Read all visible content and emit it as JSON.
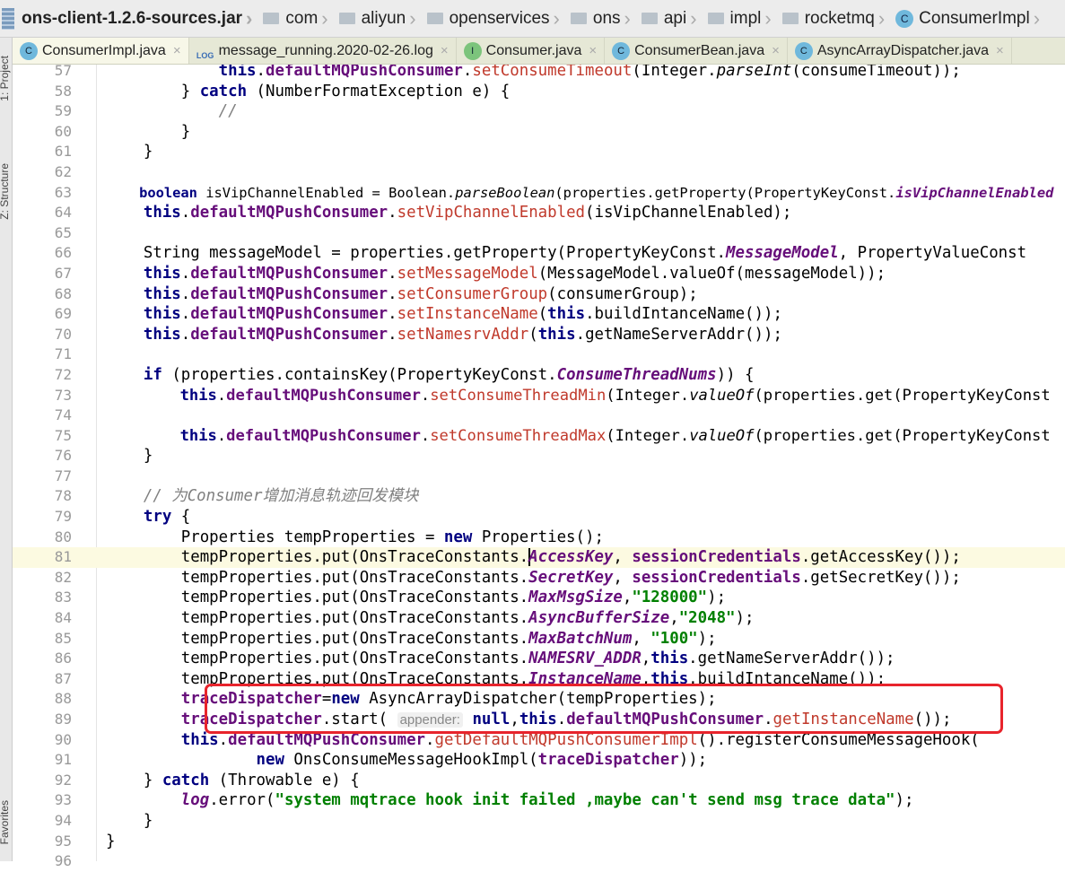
{
  "breadcrumb": {
    "root": "ons-client-1.2.6-sources.jar",
    "folders": [
      "com",
      "aliyun",
      "openservices",
      "ons",
      "api",
      "impl",
      "rocketmq"
    ],
    "class": "ConsumerImpl",
    "class_icon": "C"
  },
  "tabs": [
    {
      "label": "ConsumerImpl.java",
      "icon": "C",
      "active": true
    },
    {
      "label": "message_running.2020-02-26.log",
      "icon": "LOG"
    },
    {
      "label": "Consumer.java",
      "icon": "I"
    },
    {
      "label": "ConsumerBean.java",
      "icon": "C"
    },
    {
      "label": "AsyncArrayDispatcher.java",
      "icon": "C"
    }
  ],
  "side_labels": [
    "1: Project",
    "Z: Structure",
    "Favorites"
  ],
  "current_line": 81,
  "highlight_lines": [
    88,
    89
  ],
  "code": [
    {
      "n": 57,
      "t": [
        [
          "            ",
          ""
        ],
        [
          "this",
          "k"
        ],
        [
          ".",
          ""
        ],
        [
          "defaultMQPushConsumer",
          "f"
        ],
        [
          ".",
          ""
        ],
        [
          "setConsumeTimeout",
          "m"
        ],
        [
          "(Integer.",
          ""
        ],
        [
          "parseInt",
          "si"
        ],
        [
          "(consumeTimeout));",
          ""
        ]
      ]
    },
    {
      "n": 58,
      "t": [
        [
          "        } ",
          ""
        ],
        [
          "catch",
          "k"
        ],
        [
          " (NumberFormatException e) {",
          ""
        ]
      ]
    },
    {
      "n": 59,
      "t": [
        [
          "            ",
          ""
        ],
        [
          "//",
          "c"
        ]
      ]
    },
    {
      "n": 60,
      "t": [
        [
          "        }",
          ""
        ]
      ]
    },
    {
      "n": 61,
      "t": [
        [
          "    }",
          ""
        ]
      ]
    },
    {
      "n": 62,
      "t": []
    },
    {
      "n": 63,
      "t": [
        [
          "    ",
          ""
        ],
        [
          "boolean",
          "k"
        ],
        [
          " isVipChannelEnabled = Boolean.",
          ""
        ],
        [
          "parseBoolean",
          "si"
        ],
        [
          "(properties.getProperty(PropertyKeyConst.",
          ""
        ],
        [
          "isVipChannelEnabled",
          "s"
        ]
      ]
    },
    {
      "n": 64,
      "t": [
        [
          "    ",
          ""
        ],
        [
          "this",
          "k"
        ],
        [
          ".",
          ""
        ],
        [
          "defaultMQPushConsumer",
          "f"
        ],
        [
          ".",
          ""
        ],
        [
          "setVipChannelEnabled",
          "m"
        ],
        [
          "(isVipChannelEnabled);",
          ""
        ]
      ]
    },
    {
      "n": 65,
      "t": []
    },
    {
      "n": 66,
      "t": [
        [
          "    String messageModel = properties.getProperty(PropertyKeyConst.",
          ""
        ],
        [
          "MessageModel",
          "s"
        ],
        [
          ", PropertyValueConst",
          ""
        ]
      ]
    },
    {
      "n": 67,
      "t": [
        [
          "    ",
          ""
        ],
        [
          "this",
          "k"
        ],
        [
          ".",
          ""
        ],
        [
          "defaultMQPushConsumer",
          "f"
        ],
        [
          ".",
          ""
        ],
        [
          "setMessageModel",
          "m"
        ],
        [
          "(MessageModel.valueOf(messageModel));",
          ""
        ]
      ]
    },
    {
      "n": 68,
      "t": [
        [
          "    ",
          ""
        ],
        [
          "this",
          "k"
        ],
        [
          ".",
          ""
        ],
        [
          "defaultMQPushConsumer",
          "f"
        ],
        [
          ".",
          ""
        ],
        [
          "setConsumerGroup",
          "m"
        ],
        [
          "(consumerGroup);",
          ""
        ]
      ]
    },
    {
      "n": 69,
      "t": [
        [
          "    ",
          ""
        ],
        [
          "this",
          "k"
        ],
        [
          ".",
          ""
        ],
        [
          "defaultMQPushConsumer",
          "f"
        ],
        [
          ".",
          ""
        ],
        [
          "setInstanceName",
          "m"
        ],
        [
          "(",
          ""
        ],
        [
          "this",
          "k"
        ],
        [
          ".buildIntanceName());",
          ""
        ]
      ]
    },
    {
      "n": 70,
      "t": [
        [
          "    ",
          ""
        ],
        [
          "this",
          "k"
        ],
        [
          ".",
          ""
        ],
        [
          "defaultMQPushConsumer",
          "f"
        ],
        [
          ".",
          ""
        ],
        [
          "setNamesrvAddr",
          "m"
        ],
        [
          "(",
          ""
        ],
        [
          "this",
          "k"
        ],
        [
          ".getNameServerAddr());",
          ""
        ]
      ]
    },
    {
      "n": 71,
      "t": []
    },
    {
      "n": 72,
      "t": [
        [
          "    ",
          ""
        ],
        [
          "if",
          "k"
        ],
        [
          " (properties.containsKey(PropertyKeyConst.",
          ""
        ],
        [
          "ConsumeThreadNums",
          "s"
        ],
        [
          ")) {",
          ""
        ]
      ]
    },
    {
      "n": 73,
      "t": [
        [
          "        ",
          ""
        ],
        [
          "this",
          "k"
        ],
        [
          ".",
          ""
        ],
        [
          "defaultMQPushConsumer",
          "f"
        ],
        [
          ".",
          ""
        ],
        [
          "setConsumeThreadMin",
          "m"
        ],
        [
          "(Integer.",
          ""
        ],
        [
          "valueOf",
          "si"
        ],
        [
          "(properties.get(PropertyKeyConst",
          ""
        ]
      ]
    },
    {
      "n": 74,
      "t": []
    },
    {
      "n": 75,
      "t": [
        [
          "        ",
          ""
        ],
        [
          "this",
          "k"
        ],
        [
          ".",
          ""
        ],
        [
          "defaultMQPushConsumer",
          "f"
        ],
        [
          ".",
          ""
        ],
        [
          "setConsumeThreadMax",
          "m"
        ],
        [
          "(Integer.",
          ""
        ],
        [
          "valueOf",
          "si"
        ],
        [
          "(properties.get(PropertyKeyConst",
          ""
        ]
      ]
    },
    {
      "n": 76,
      "t": [
        [
          "    }",
          ""
        ]
      ]
    },
    {
      "n": 77,
      "t": []
    },
    {
      "n": 78,
      "t": [
        [
          "    ",
          ""
        ],
        [
          "// 为",
          "c"
        ],
        [
          "Consumer",
          "c"
        ],
        [
          "增加消息轨迹回发模块",
          "c"
        ]
      ]
    },
    {
      "n": 79,
      "t": [
        [
          "    ",
          ""
        ],
        [
          "try",
          "k"
        ],
        [
          " {",
          ""
        ]
      ]
    },
    {
      "n": 80,
      "t": [
        [
          "        Properties tempProperties = ",
          ""
        ],
        [
          "new",
          "k"
        ],
        [
          " Properties();",
          ""
        ]
      ]
    },
    {
      "n": 81,
      "t": [
        [
          "        tempProperties.put(OnsTraceConstants.",
          ""
        ],
        [
          "AccessKey",
          "s"
        ],
        [
          ", ",
          ""
        ],
        [
          "sessionCredentials",
          "f"
        ],
        [
          ".getAccessKey());",
          ""
        ]
      ]
    },
    {
      "n": 82,
      "t": [
        [
          "        tempProperties.put(OnsTraceConstants.",
          ""
        ],
        [
          "SecretKey",
          "s"
        ],
        [
          ", ",
          ""
        ],
        [
          "sessionCredentials",
          "f"
        ],
        [
          ".getSecretKey());",
          ""
        ]
      ]
    },
    {
      "n": 83,
      "t": [
        [
          "        tempProperties.put(OnsTraceConstants.",
          ""
        ],
        [
          "MaxMsgSize",
          "s"
        ],
        [
          ",",
          ""
        ],
        [
          "\"128000\"",
          "str"
        ],
        [
          ");",
          ""
        ]
      ]
    },
    {
      "n": 84,
      "t": [
        [
          "        tempProperties.put(OnsTraceConstants.",
          ""
        ],
        [
          "AsyncBufferSize",
          "s"
        ],
        [
          ",",
          ""
        ],
        [
          "\"2048\"",
          "str"
        ],
        [
          ");",
          ""
        ]
      ]
    },
    {
      "n": 85,
      "t": [
        [
          "        tempProperties.put(OnsTraceConstants.",
          ""
        ],
        [
          "MaxBatchNum",
          "s"
        ],
        [
          ", ",
          ""
        ],
        [
          "\"100\"",
          "str"
        ],
        [
          ");",
          ""
        ]
      ]
    },
    {
      "n": 86,
      "t": [
        [
          "        tempProperties.put(OnsTraceConstants.",
          ""
        ],
        [
          "NAMESRV_ADDR",
          "s"
        ],
        [
          ",",
          ""
        ],
        [
          "this",
          "k"
        ],
        [
          ".getNameServerAddr());",
          ""
        ]
      ]
    },
    {
      "n": 87,
      "t": [
        [
          "        tempProperties.put(OnsTraceConstants.",
          ""
        ],
        [
          "InstanceName",
          "s"
        ],
        [
          ",",
          ""
        ],
        [
          "this",
          "k"
        ],
        [
          ".buildIntanceName());",
          ""
        ]
      ]
    },
    {
      "n": 88,
      "t": [
        [
          "        ",
          ""
        ],
        [
          "traceDispatcher",
          "f"
        ],
        [
          "=",
          ""
        ],
        [
          "new",
          "k"
        ],
        [
          " AsyncArrayDispatcher(tempProperties);",
          ""
        ]
      ]
    },
    {
      "n": 89,
      "t": [
        [
          "        ",
          ""
        ],
        [
          "traceDispatcher",
          "f"
        ],
        [
          ".start( ",
          ""
        ],
        [
          "appender:",
          "h"
        ],
        [
          " ",
          ""
        ],
        [
          "null",
          "k"
        ],
        [
          ",",
          ""
        ],
        [
          "this",
          "k"
        ],
        [
          ".",
          ""
        ],
        [
          "defaultMQPushConsumer",
          "f"
        ],
        [
          ".",
          ""
        ],
        [
          "getInstanceName",
          "m"
        ],
        [
          "());",
          ""
        ]
      ]
    },
    {
      "n": 90,
      "t": [
        [
          "        ",
          ""
        ],
        [
          "this",
          "k"
        ],
        [
          ".",
          ""
        ],
        [
          "defaultMQPushConsumer",
          "f"
        ],
        [
          ".",
          ""
        ],
        [
          "getDefaultMQPushConsumerImpl",
          "m"
        ],
        [
          "().registerConsumeMessageHook(",
          ""
        ]
      ]
    },
    {
      "n": 91,
      "t": [
        [
          "                ",
          ""
        ],
        [
          "new",
          "k"
        ],
        [
          " OnsConsumeMessageHookImpl(",
          ""
        ],
        [
          "traceDispatcher",
          "f"
        ],
        [
          "));",
          ""
        ]
      ]
    },
    {
      "n": 92,
      "t": [
        [
          "    } ",
          ""
        ],
        [
          "catch",
          "k"
        ],
        [
          " (Throwable e) {",
          ""
        ]
      ]
    },
    {
      "n": 93,
      "t": [
        [
          "        ",
          ""
        ],
        [
          "log",
          "s"
        ],
        [
          ".error(",
          ""
        ],
        [
          "\"system mqtrace hook init failed ,maybe can't send msg trace data\"",
          "str"
        ],
        [
          ");",
          ""
        ]
      ]
    },
    {
      "n": 94,
      "t": [
        [
          "    }",
          ""
        ]
      ]
    },
    {
      "n": 95,
      "t": [
        [
          "}",
          ""
        ]
      ]
    },
    {
      "n": 96,
      "t": []
    }
  ]
}
